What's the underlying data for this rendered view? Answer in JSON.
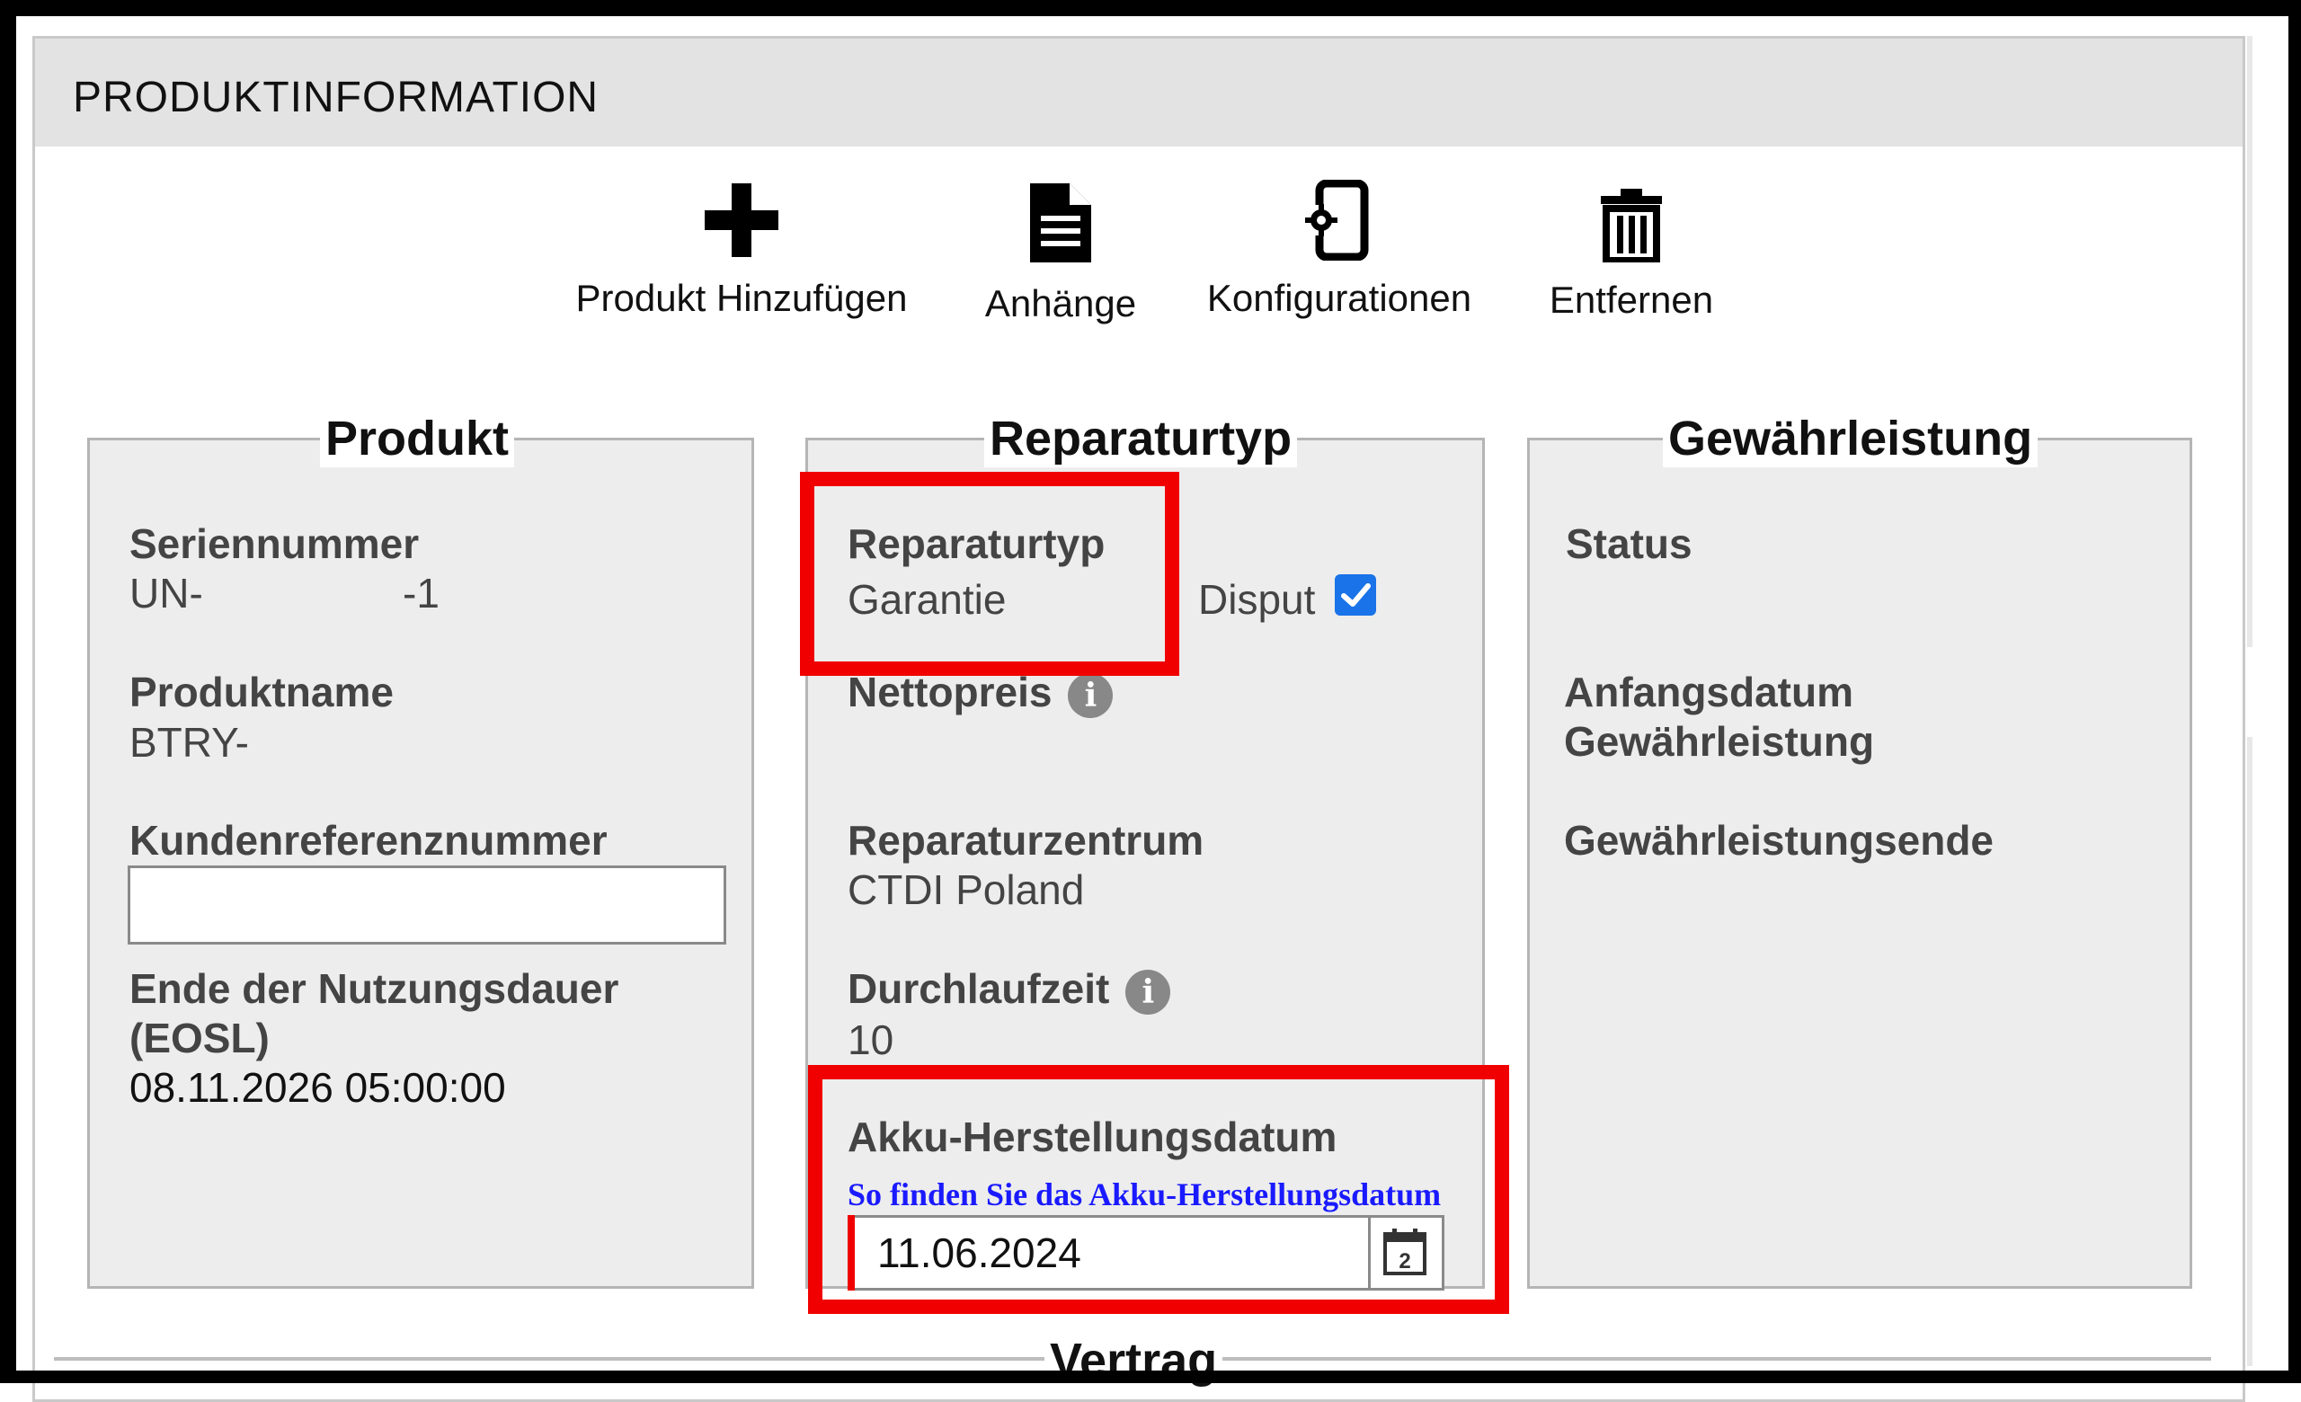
{
  "panel": {
    "title": "PRODUKTINFORMATION"
  },
  "toolbar": [
    {
      "label": "Produkt Hinzufügen",
      "icon": "plus-icon"
    },
    {
      "label": "Anhänge",
      "icon": "document-icon"
    },
    {
      "label": "Konfigurationen",
      "icon": "device-settings-icon"
    },
    {
      "label": "Entfernen",
      "icon": "trash-icon"
    }
  ],
  "produkt": {
    "legend": "Produkt",
    "serial_label": "Seriennummer",
    "serial_prefix": "UN-",
    "serial_suffix": "-1",
    "name_label": "Produktname",
    "name_value": "BTRY-",
    "customer_ref_label": "Kundenreferenznummer",
    "customer_ref_value": "",
    "eosl_label_line1": "Ende der Nutzungsdauer",
    "eosl_label_line2": "(EOSL)",
    "eosl_value": "08.11.2026 05:00:00"
  },
  "reparaturtyp": {
    "legend": "Reparaturtyp",
    "type_label": "Reparaturtyp",
    "type_value": "Garantie",
    "disput_label": "Disput",
    "disput_checked": true,
    "net_price_label": "Nettopreis",
    "center_label": "Reparaturzentrum",
    "center_value": "CTDI Poland",
    "turnaround_label": "Durchlaufzeit",
    "turnaround_value": "10",
    "battery_date_label": "Akku-Herstellungsdatum",
    "battery_help_link": "So finden Sie das Akku-Herstellungsdatum",
    "battery_date_value": "11.06.2024",
    "info_glyph": "i",
    "calendar_day": "2"
  },
  "gewaehrleistung": {
    "legend": "Gewährleistung",
    "status_label": "Status",
    "start_label_line1": "Anfangsdatum",
    "start_label_line2": "Gewährleistung",
    "end_label": "Gewährleistungsende"
  },
  "vertrag": {
    "legend": "Vertrag"
  },
  "colors": {
    "highlight": "#f00000",
    "link": "#1a1aff",
    "checkbox": "#1a73e8",
    "header_bg": "#e3e3e3",
    "box_bg": "#ededed"
  }
}
